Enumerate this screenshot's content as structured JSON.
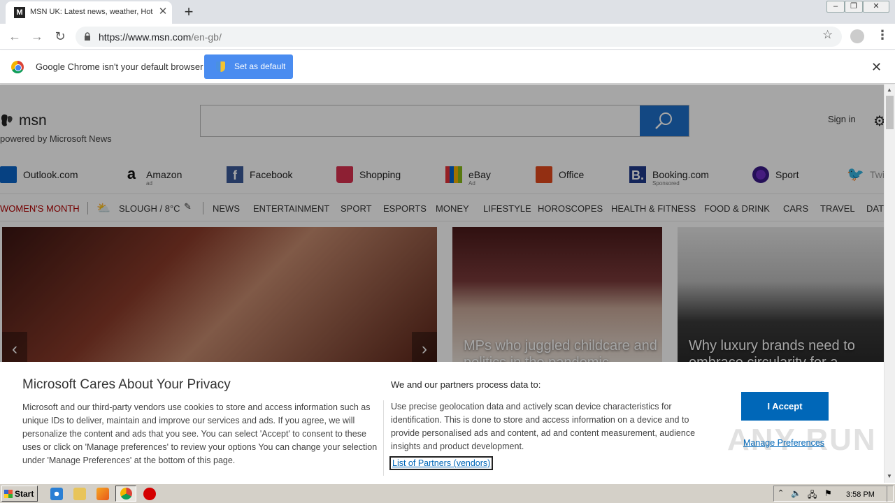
{
  "browser": {
    "tab_title": "MSN UK: Latest news, weather, Hot",
    "tab_icon": "msn-icon",
    "url_host": "https://www.msn.com",
    "url_path": "/en-gb/",
    "window_buttons": [
      "minimize-icon",
      "restore-icon",
      "close-icon"
    ]
  },
  "infobar": {
    "message": "Google Chrome isn't your default browser",
    "button": "Set as default"
  },
  "header": {
    "logo_text": "msn",
    "powered_by": "powered by Microsoft News",
    "search_placeholder": "",
    "sign_in": "Sign in"
  },
  "quick_links": [
    {
      "label": "Outlook.com",
      "sub": "",
      "icon": "outlook-icon"
    },
    {
      "label": "Amazon",
      "sub": "ad",
      "icon": "amazon-icon"
    },
    {
      "label": "Facebook",
      "sub": "",
      "icon": "facebook-icon"
    },
    {
      "label": "Shopping",
      "sub": "",
      "icon": "shopping-bag-icon"
    },
    {
      "label": "eBay",
      "sub": "Ad",
      "icon": "ebay-icon"
    },
    {
      "label": "Office",
      "sub": "",
      "icon": "office-icon"
    },
    {
      "label": "Booking.com",
      "sub": "Sponsored",
      "icon": "booking-icon"
    },
    {
      "label": "Sport",
      "sub": "",
      "icon": "sport-icon"
    },
    {
      "label": "Twit",
      "sub": "",
      "icon": "twitter-icon"
    }
  ],
  "nav": {
    "womens_month": "WOMEN'S MONTH",
    "weather": "SLOUGH / 8°C",
    "items": [
      "NEWS",
      "ENTERTAINMENT",
      "SPORT",
      "ESPORTS",
      "MONEY",
      "LIFESTYLE",
      "HOROSCOPES",
      "HEALTH & FITNESS",
      "FOOD & DRINK",
      "CARS",
      "TRAVEL",
      "DAT"
    ]
  },
  "heroes": [
    {
      "headline": ""
    },
    {
      "headline": "MPs who juggled childcare and politics in the pandemic"
    },
    {
      "headline": "Why luxury brands need to embrace circularity for a"
    }
  ],
  "privacy": {
    "title": "Microsoft Cares About Your Privacy",
    "body": "Microsoft and our third-party vendors use cookies to store and access information such as unique IDs to deliver, maintain and improve our services and ads. If you agree, we will personalize the content and ads that you see. You can select 'Accept' to consent to these uses or click on 'Manage preferences' to review your options  You can change your selection under 'Manage Preferences' at the bottom of this page.",
    "partners_title": "We and our partners process data to:",
    "partners_body": "Use precise geolocation data and actively scan device characteristics for identification. This is done to store and access information on a device and to provide personalised ads and content, ad and content measurement, audience insights and product development.",
    "partners_link": "List of Partners (vendors)",
    "accept": "I Accept",
    "manage": "Manage Preferences",
    "watermark": "ANY RUN"
  },
  "taskbar": {
    "start": "Start",
    "clock": "3:58 PM"
  }
}
